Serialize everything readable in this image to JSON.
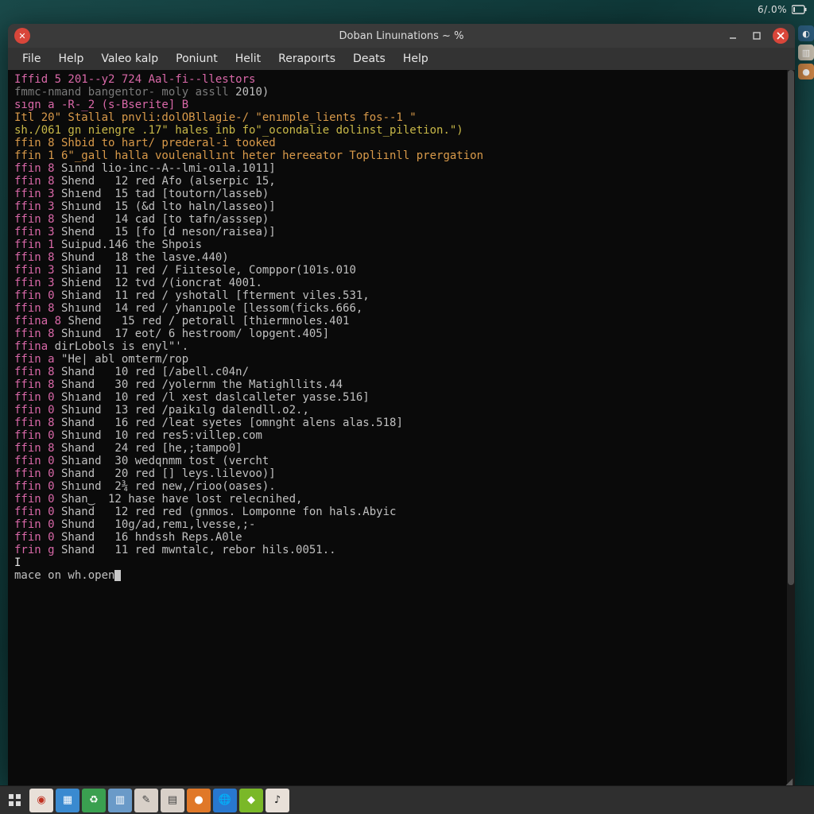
{
  "systray": {
    "battery_text": "6/.0%"
  },
  "rightdock": {
    "items": [
      {
        "name": "dock-clock",
        "bg": "#2a5a7a",
        "glyph": "◐"
      },
      {
        "name": "dock-files",
        "bg": "#c8c0b0",
        "glyph": "▥"
      },
      {
        "name": "dock-app",
        "bg": "#d08848",
        "glyph": "●"
      }
    ]
  },
  "window": {
    "title": "Doban Linuınations ~ %",
    "app_icon_glyph": "✕"
  },
  "menubar": {
    "items": [
      {
        "label": "File"
      },
      {
        "label": "Help"
      },
      {
        "label": "Valeo kalp"
      },
      {
        "label": "Poniunt"
      },
      {
        "label": "Helit"
      },
      {
        "label": "Rerapoırts"
      },
      {
        "label": "Deats"
      },
      {
        "label": "Help"
      }
    ]
  },
  "terminal": {
    "lines": [
      {
        "segs": [
          {
            "c": "pink",
            "t": "Iffid 5 201--y2 724 Aal-fi--llestors"
          }
        ]
      },
      {
        "segs": [
          {
            "c": "dim",
            "t": "fmmc-nmand bangentor- moly assll "
          },
          {
            "c": "grey",
            "t": "2010)"
          }
        ]
      },
      {
        "segs": [
          {
            "c": "pink",
            "t": "sıgn a -R-_2 (s-Bserite] B"
          }
        ]
      },
      {
        "segs": [
          {
            "c": "orange",
            "t": "Itl 20\" Stallal pnvli:dolOBllagie-/ \"enımple_lients fos--1 \""
          }
        ]
      },
      {
        "segs": [
          {
            "c": "yellow",
            "t": "sh./061 gn niengre .17\" hales inb fo\"_ocondalie dolinst_piletion.\")"
          }
        ]
      },
      {
        "segs": [
          {
            "c": "orange",
            "t": "ffin 8 Shbid to hart/ prederal-i tooked"
          }
        ]
      },
      {
        "segs": [
          {
            "c": "orange",
            "t": "ffin 1 6\"_gall halla voulenallınt heter hereeator Topliınll prergation"
          }
        ]
      },
      {
        "segs": [
          {
            "c": "pink",
            "t": "ffin 8"
          },
          {
            "c": "grey",
            "t": " Sınnd lio-inc--A--lmi-oıla.1011]"
          }
        ]
      },
      {
        "segs": [
          {
            "c": "pink",
            "t": "ffin 8"
          },
          {
            "c": "grey",
            "t": " Shend   12 red Afo (alserpic 15,"
          }
        ]
      },
      {
        "segs": [
          {
            "c": "pink",
            "t": "ffin 3"
          },
          {
            "c": "grey",
            "t": " Shıend  15 tad [toutorn/lasseb)"
          }
        ]
      },
      {
        "segs": [
          {
            "c": "pink",
            "t": "ffin 3"
          },
          {
            "c": "grey",
            "t": " Shıund  15 (&d lto haln/lasseo)]"
          }
        ]
      },
      {
        "segs": [
          {
            "c": "pink",
            "t": "ffin 8"
          },
          {
            "c": "grey",
            "t": " Shend   14 cad [to tafn/asssep)"
          }
        ]
      },
      {
        "segs": [
          {
            "c": "pink",
            "t": "ffin 3"
          },
          {
            "c": "grey",
            "t": " Shend   15 [fo [d neson/raisea)]"
          }
        ]
      },
      {
        "segs": [
          {
            "c": "pink",
            "t": "ffin 1"
          },
          {
            "c": "grey",
            "t": " Suipud.146 the Shpois"
          }
        ]
      },
      {
        "segs": [
          {
            "c": "pink",
            "t": "ffin 8"
          },
          {
            "c": "grey",
            "t": " Shund   18 the lasve.440)"
          }
        ]
      },
      {
        "segs": [
          {
            "c": "pink",
            "t": "ffin 3"
          },
          {
            "c": "grey",
            "t": " Shiand  11 red / Fiıtesole, Comppor(101s.010"
          }
        ]
      },
      {
        "segs": [
          {
            "c": "pink",
            "t": "ffin 3"
          },
          {
            "c": "grey",
            "t": " Shiend  12 tvd /(ioncrat 4001."
          }
        ]
      },
      {
        "segs": [
          {
            "c": "pink",
            "t": "ffin 0"
          },
          {
            "c": "grey",
            "t": " Shiand  11 red / yshotall [fterment viles.531,"
          }
        ]
      },
      {
        "segs": [
          {
            "c": "pink",
            "t": "ffin 8"
          },
          {
            "c": "grey",
            "t": " Shıund  14 red / yhanıpole [lessom(ficks.666,"
          }
        ]
      },
      {
        "segs": [
          {
            "c": "pink",
            "t": "ffina 8"
          },
          {
            "c": "grey",
            "t": " Shend   15 red / petorall [thiermnoles.401"
          }
        ]
      },
      {
        "segs": [
          {
            "c": "pink",
            "t": "ffin 8"
          },
          {
            "c": "grey",
            "t": " Shıund  17 eot/ 6 hestroom/ lopgent.405]"
          }
        ]
      },
      {
        "segs": [
          {
            "c": "pink",
            "t": "ffina "
          },
          {
            "c": "grey",
            "t": "dirLobols is enyl\"'."
          }
        ]
      },
      {
        "segs": [
          {
            "c": "pink",
            "t": "ffin a "
          },
          {
            "c": "grey",
            "t": "\"He| abl omterm/rop"
          }
        ]
      },
      {
        "segs": [
          {
            "c": "pink",
            "t": "ffin 8"
          },
          {
            "c": "grey",
            "t": " Shand   10 red [/abell.c04n/"
          }
        ]
      },
      {
        "segs": [
          {
            "c": "pink",
            "t": "ffin 8"
          },
          {
            "c": "grey",
            "t": " Shand   30 red /yolernm the Matighllits.44"
          }
        ]
      },
      {
        "segs": [
          {
            "c": "pink",
            "t": "ffin 0"
          },
          {
            "c": "grey",
            "t": " Shıand  10 red /l xest daslcalleter yasse.516]"
          }
        ]
      },
      {
        "segs": [
          {
            "c": "pink",
            "t": "ffin 0"
          },
          {
            "c": "grey",
            "t": " Shıund  13 red /paikılg dalendll.o2.,"
          }
        ]
      },
      {
        "segs": [
          {
            "c": "pink",
            "t": "ffin 8"
          },
          {
            "c": "grey",
            "t": " Shand   16 red /leat syetes [omnght alens alas.518]"
          }
        ]
      },
      {
        "segs": [
          {
            "c": "pink",
            "t": "ffin 0"
          },
          {
            "c": "grey",
            "t": " Shıund  10 red res5:villep.com"
          }
        ]
      },
      {
        "segs": [
          {
            "c": "pink",
            "t": "ffin 8"
          },
          {
            "c": "grey",
            "t": " Shand   24 red [he,;tampo0]"
          }
        ]
      },
      {
        "segs": [
          {
            "c": "pink",
            "t": "ffin 0"
          },
          {
            "c": "grey",
            "t": " Shıand  30 wedqnmm tost (vercht"
          }
        ]
      },
      {
        "segs": [
          {
            "c": "pink",
            "t": "ffin 0"
          },
          {
            "c": "grey",
            "t": " Shand   20 red [] leys.lilevoo)]"
          }
        ]
      },
      {
        "segs": [
          {
            "c": "pink",
            "t": "ffin 0"
          },
          {
            "c": "grey",
            "t": " Shıund  2¾ red new,/rioo(oases)."
          }
        ]
      },
      {
        "segs": [
          {
            "c": "pink",
            "t": "ffin 0"
          },
          {
            "c": "grey",
            "t": " Shan‿  12 hase have lost relecnihed,"
          }
        ]
      },
      {
        "segs": [
          {
            "c": "pink",
            "t": "ffin 0"
          },
          {
            "c": "grey",
            "t": " Shand   12 red red (gnmos. Lomponne fon hals.Abyic"
          }
        ]
      },
      {
        "segs": [
          {
            "c": "pink",
            "t": "ffin 0"
          },
          {
            "c": "grey",
            "t": " Shund   10g/ad,remı,lvesse,;-"
          }
        ]
      },
      {
        "segs": [
          {
            "c": "pink",
            "t": "ffin 0"
          },
          {
            "c": "grey",
            "t": " Shand   16 hndssh Reps.A0le"
          }
        ]
      },
      {
        "segs": [
          {
            "c": "pink",
            "t": "frin g"
          },
          {
            "c": "grey",
            "t": " Shand   11 red mwntalc, rebor hils.0051.."
          }
        ]
      },
      {
        "segs": [
          {
            "c": "white",
            "t": "I"
          }
        ]
      },
      {
        "segs": [
          {
            "c": "grey",
            "t": "mace on wh.open"
          }
        ],
        "cursor": true
      }
    ]
  },
  "taskbar": {
    "launcher_glyph": "⊞",
    "items": [
      {
        "name": "tb-disc",
        "bg": "#e8e0d8",
        "glyph": "◉",
        "fg": "#c03020"
      },
      {
        "name": "tb-windows",
        "bg": "#3a8ad0",
        "glyph": "▦",
        "fg": "#fff"
      },
      {
        "name": "tb-recycle",
        "bg": "#3aa050",
        "glyph": "♻",
        "fg": "#fff"
      },
      {
        "name": "tb-files",
        "bg": "#6a9ac8",
        "glyph": "▥",
        "fg": "#fff"
      },
      {
        "name": "tb-doc1",
        "bg": "#d8d0c8",
        "glyph": "✎",
        "fg": "#444"
      },
      {
        "name": "tb-doc2",
        "bg": "#d8d0c8",
        "glyph": "▤",
        "fg": "#444"
      },
      {
        "name": "tb-orange",
        "bg": "#e07828",
        "glyph": "●",
        "fg": "#fff"
      },
      {
        "name": "tb-globe",
        "bg": "#2878d0",
        "glyph": "🌐",
        "fg": "#fff"
      },
      {
        "name": "tb-green",
        "bg": "#7ab828",
        "glyph": "◆",
        "fg": "#fff"
      },
      {
        "name": "tb-music",
        "bg": "#e8e0d8",
        "glyph": "♪",
        "fg": "#222"
      }
    ]
  }
}
